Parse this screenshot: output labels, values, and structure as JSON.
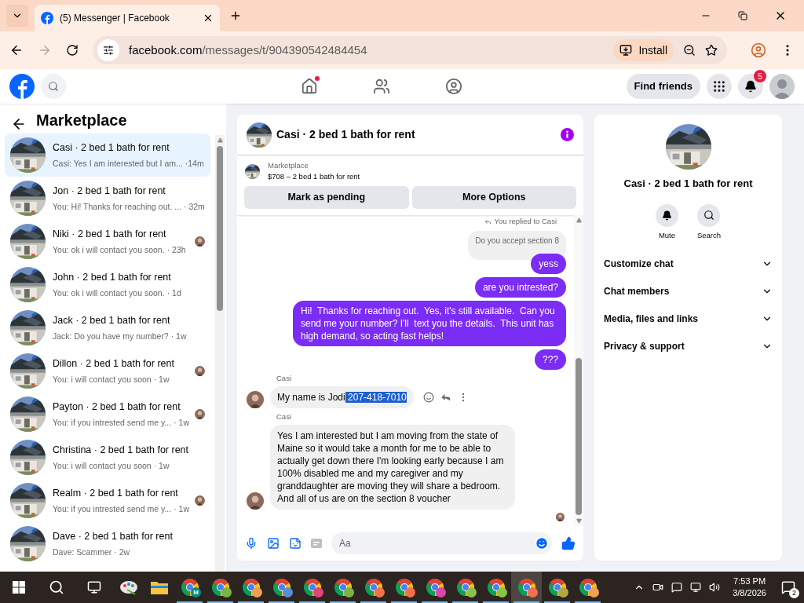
{
  "browser": {
    "tab_title": "(5) Messenger | Facebook",
    "url_host": "facebook.com",
    "url_path": "/messages/t/904390542484454",
    "install_label": "Install"
  },
  "nav": {
    "home_dot": true,
    "find_friends": "Find friends",
    "notification_count": "5"
  },
  "sidebar": {
    "title": "Marketplace",
    "items": [
      {
        "title": "Casi · 2 bed 1 bath for rent",
        "preview": "Casi: Yes I am interested but I am...",
        "time": "·14m",
        "selected": true,
        "seen": false
      },
      {
        "title": "Jon · 2 bed 1 bath for rent",
        "preview": "You: Hi! Thanks for reaching out. ...",
        "time": "· 32m",
        "selected": false,
        "seen": false
      },
      {
        "title": "Niki · 2 bed 1 bath for rent",
        "preview": "You: ok i will contact you soon.",
        "time": "· 23h",
        "selected": false,
        "seen": true
      },
      {
        "title": "John · 2 bed 1 bath for rent",
        "preview": "You: ok i will contact you soon.",
        "time": "· 1d",
        "selected": false,
        "seen": false
      },
      {
        "title": "Jack · 2 bed 1 bath for rent",
        "preview": "Jack: Do you have my number?",
        "time": "· 1w",
        "selected": false,
        "seen": false
      },
      {
        "title": "Dillon · 2 bed 1 bath for rent",
        "preview": "You: i will contact you soon",
        "time": "· 1w",
        "selected": false,
        "seen": true
      },
      {
        "title": "Payton · 2 bed 1 bath for rent",
        "preview": "You: if you intrested send me y...",
        "time": "· 1w",
        "selected": false,
        "seen": true
      },
      {
        "title": "Christina · 2 bed 1 bath for rent",
        "preview": "You: i will contact you soon",
        "time": "· 1w",
        "selected": false,
        "seen": false
      },
      {
        "title": "Realm · 2 bed 1 bath for rent",
        "preview": "You: if you intrested send me y...",
        "time": "· 1w",
        "selected": false,
        "seen": true
      },
      {
        "title": "Dave · 2 bed 1 bath for rent",
        "preview": "Dave: Scammer",
        "time": "· 2w",
        "selected": false,
        "seen": false
      }
    ]
  },
  "chat": {
    "title": "Casi · 2 bed 1 bath for rent",
    "listing": {
      "label": "Marketplace",
      "detail": "$708 – 2 bed 1 bath for rent"
    },
    "actions": [
      "Mark as pending",
      "More Options"
    ],
    "messages": [
      {
        "kind": "reply_note",
        "text": "You replied to Casi"
      },
      {
        "kind": "quoted",
        "text": "Do you accept section 8"
      },
      {
        "kind": "outgoing",
        "text": "yess"
      },
      {
        "kind": "outgoing",
        "text": "are you intrested?"
      },
      {
        "kind": "outgoing",
        "text": "Hi!  Thanks for reaching out.  Yes, it's still available.  Can you send me your number? I'll  text you the details.  This unit has high demand, so acting fast helps!"
      },
      {
        "kind": "outgoing",
        "text": "???"
      },
      {
        "kind": "incoming",
        "sender": "Casi",
        "show_actions": true,
        "parts": [
          {
            "text": "My name is Jodi",
            "selected": false
          },
          {
            "text": " 207-418-7010",
            "selected": true
          }
        ]
      },
      {
        "kind": "incoming",
        "sender": "Casi",
        "show_actions": false,
        "parts": [
          {
            "text": "Yes I am interested but I am moving from the state of Maine so it would take a month for me to be able to actually get down there I'm looking early because I am 100% disabled me and my caregiver and my granddaughter are moving they will share a bedroom. And all of us are on the section 8 voucher",
            "selected": false
          }
        ]
      }
    ],
    "seen": true,
    "composer": {
      "placeholder": "Aa"
    }
  },
  "details": {
    "title": "Casi · 2 bed 1 bath for rent",
    "actions": [
      {
        "kind": "mute",
        "label": "Mute"
      },
      {
        "kind": "search",
        "label": "Search"
      }
    ],
    "sections": [
      {
        "label": "Customize chat",
        "expanded": false
      },
      {
        "label": "Chat members",
        "expanded": false
      },
      {
        "label": "Media, files and links",
        "expanded": false
      },
      {
        "label": "Privacy & support",
        "expanded": false
      }
    ]
  },
  "taskbar": {
    "apps": [
      {
        "kind": "paint",
        "selected": false
      },
      {
        "kind": "folder",
        "selected": false
      },
      {
        "kind": "chrome",
        "color": "#0b8a7c",
        "badge_text": "M",
        "selected": false
      },
      {
        "kind": "chrome",
        "color": "#7cb342",
        "selected": false
      },
      {
        "kind": "chrome",
        "color": "#f0a050",
        "selected": false
      },
      {
        "kind": "chrome",
        "color": "#5b8dd6",
        "selected": false
      },
      {
        "kind": "chrome",
        "color": "#e0457a",
        "selected": false
      },
      {
        "kind": "chrome",
        "color": "#7cb342",
        "selected": false
      },
      {
        "kind": "chrome",
        "color": "#f07050",
        "selected": false
      },
      {
        "kind": "chrome",
        "color": "#f07050",
        "selected": false
      },
      {
        "kind": "chrome",
        "color": "#d946a8",
        "selected": false
      },
      {
        "kind": "chrome",
        "color": "#8bc34a",
        "selected": false
      },
      {
        "kind": "chrome",
        "color": "#8bc34a",
        "selected": false
      },
      {
        "kind": "chrome",
        "color": "#f07050",
        "selected": true
      },
      {
        "kind": "chrome",
        "color": "#b5a642",
        "selected": false
      },
      {
        "kind": "chrome",
        "color": "#f0a050",
        "selected": false
      }
    ],
    "time": "7:53 PM",
    "date": "3/8/2026",
    "notifications": "2"
  }
}
